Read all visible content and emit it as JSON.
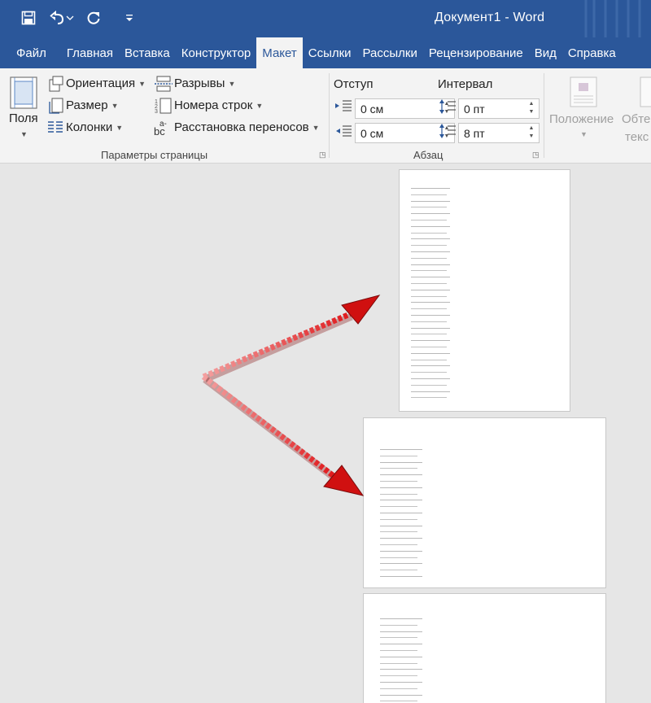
{
  "window": {
    "title": "Документ1  -  Word"
  },
  "qat": {
    "save_icon": "save-icon",
    "undo_icon": "undo-icon",
    "redo_icon": "redo-icon",
    "customize_icon": "chevron-down-icon"
  },
  "tabs": [
    {
      "label": "Файл"
    },
    {
      "label": "Главная"
    },
    {
      "label": "Вставка"
    },
    {
      "label": "Конструктор"
    },
    {
      "label": "Макет",
      "active": true
    },
    {
      "label": "Ссылки"
    },
    {
      "label": "Рассылки"
    },
    {
      "label": "Рецензирование"
    },
    {
      "label": "Вид"
    },
    {
      "label": "Справка"
    }
  ],
  "ribbon": {
    "page_setup": {
      "label": "Параметры страницы",
      "margins": "Поля",
      "orientation": "Ориентация",
      "size": "Размер",
      "columns": "Колонки",
      "breaks": "Разрывы",
      "line_numbers": "Номера строк",
      "hyphenation": "Расстановка переносов"
    },
    "paragraph": {
      "label": "Абзац",
      "indent_title": "Отступ",
      "spacing_title": "Интервал",
      "indent_left": "0 см",
      "indent_right": "0 см",
      "spacing_before": "0 пт",
      "spacing_after": "8 пт"
    },
    "arrange": {
      "position": "Положение",
      "wrap_line1": "Обте",
      "wrap_line2": "текс"
    }
  },
  "colors": {
    "accent": "#2b579a",
    "ribbon_bg": "#f3f3f3",
    "canvas_bg": "#e6e6e6",
    "arrow": "#e0191c"
  }
}
